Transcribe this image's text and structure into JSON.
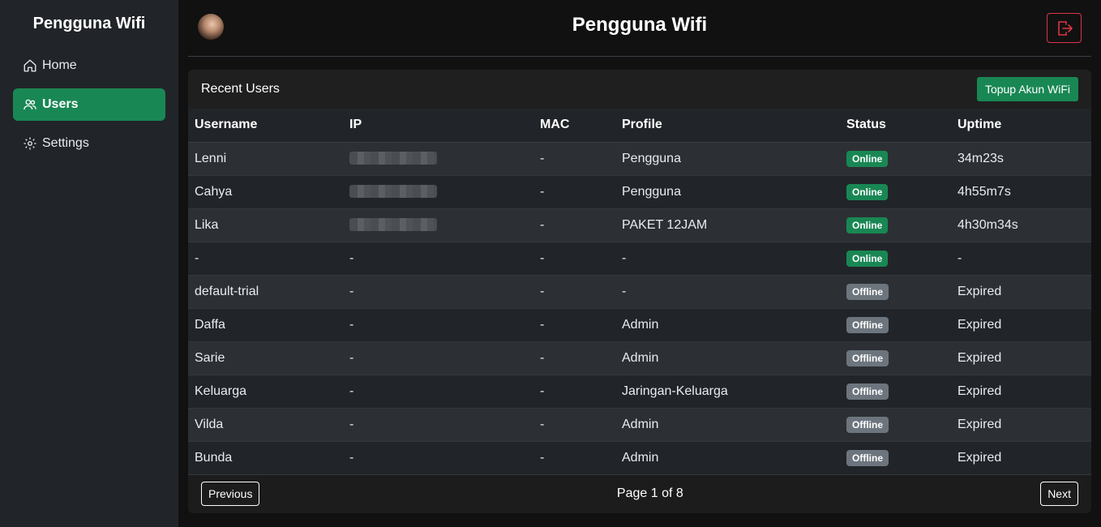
{
  "sidebar": {
    "brand": "Pengguna Wifi",
    "items": [
      {
        "label": "Home",
        "icon": "home-icon",
        "active": false
      },
      {
        "label": "Users",
        "icon": "users-icon",
        "active": true
      },
      {
        "label": "Settings",
        "icon": "gear-icon",
        "active": false
      }
    ]
  },
  "header": {
    "title": "Pengguna Wifi",
    "logout_icon": "logout-icon"
  },
  "card": {
    "title": "Recent Users",
    "topup_label": "Topup Akun WiFi"
  },
  "table": {
    "columns": [
      "Username",
      "IP",
      "MAC",
      "Profile",
      "Status",
      "Uptime"
    ],
    "rows": [
      {
        "username": "Lenni",
        "ip": "",
        "ip_hidden": true,
        "mac": "-",
        "profile": "Pengguna",
        "status": "Online",
        "uptime": "34m23s"
      },
      {
        "username": "Cahya",
        "ip": "",
        "ip_hidden": true,
        "mac": "-",
        "profile": "Pengguna",
        "status": "Online",
        "uptime": "4h55m7s"
      },
      {
        "username": "Lika",
        "ip": "",
        "ip_hidden": true,
        "mac": "-",
        "profile": "PAKET 12JAM",
        "status": "Online",
        "uptime": "4h30m34s"
      },
      {
        "username": "-",
        "ip": "-",
        "ip_hidden": false,
        "mac": "-",
        "profile": "-",
        "status": "Online",
        "uptime": "-"
      },
      {
        "username": "default-trial",
        "ip": "-",
        "ip_hidden": false,
        "mac": "-",
        "profile": "-",
        "status": "Offline",
        "uptime": "Expired"
      },
      {
        "username": "Daffa",
        "ip": "-",
        "ip_hidden": false,
        "mac": "-",
        "profile": "Admin",
        "status": "Offline",
        "uptime": "Expired"
      },
      {
        "username": "Sarie",
        "ip": "-",
        "ip_hidden": false,
        "mac": "-",
        "profile": "Admin",
        "status": "Offline",
        "uptime": "Expired"
      },
      {
        "username": "Keluarga",
        "ip": "-",
        "ip_hidden": false,
        "mac": "-",
        "profile": "Jaringan-Keluarga",
        "status": "Offline",
        "uptime": "Expired"
      },
      {
        "username": "Vilda",
        "ip": "-",
        "ip_hidden": false,
        "mac": "-",
        "profile": "Admin",
        "status": "Offline",
        "uptime": "Expired"
      },
      {
        "username": "Bunda",
        "ip": "-",
        "ip_hidden": false,
        "mac": "-",
        "profile": "Admin",
        "status": "Offline",
        "uptime": "Expired"
      }
    ]
  },
  "pagination": {
    "previous_label": "Previous",
    "next_label": "Next",
    "page_info": "Page 1 of 8"
  },
  "colors": {
    "accent": "#198754",
    "offline": "#6c757d",
    "danger": "#dc3545",
    "sidebar_bg": "#212529",
    "page_bg": "#111111"
  }
}
